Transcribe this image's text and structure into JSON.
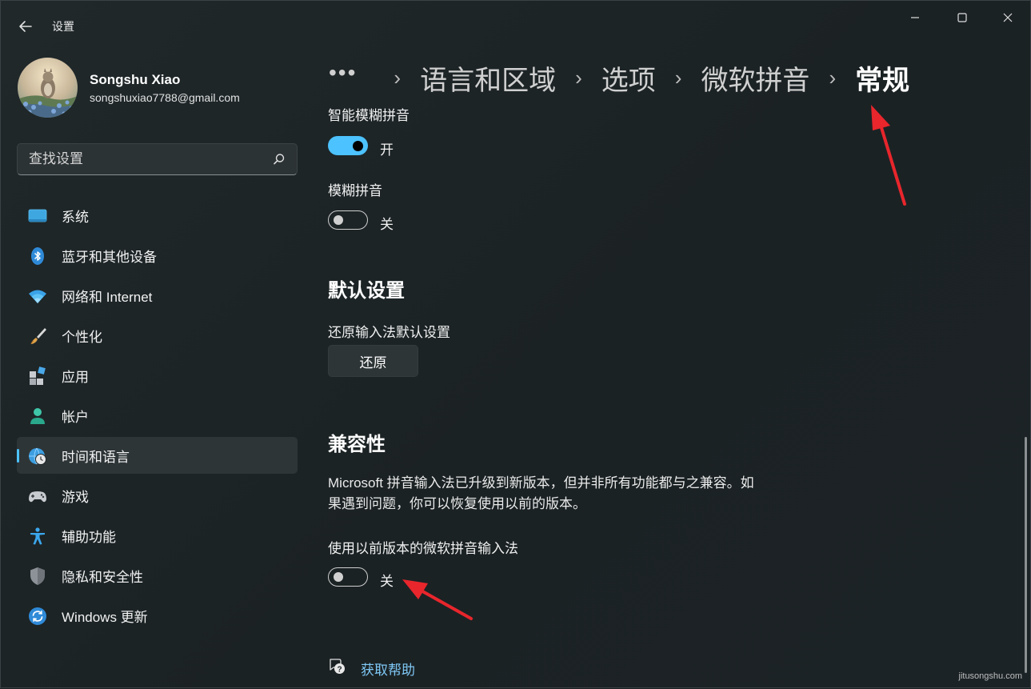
{
  "window": {
    "title": "设置",
    "controls": [
      "minimize-icon",
      "maximize-icon",
      "close-icon"
    ]
  },
  "profile": {
    "name": "Songshu Xiao",
    "email": "songshuxiao7788@gmail.com"
  },
  "search": {
    "placeholder": "查找设置"
  },
  "sidebar": {
    "items": [
      {
        "label": "系统",
        "icon": "system-icon",
        "active": false
      },
      {
        "label": "蓝牙和其他设备",
        "icon": "bluetooth-icon",
        "active": false
      },
      {
        "label": "网络和 Internet",
        "icon": "wifi-icon",
        "active": false
      },
      {
        "label": "个性化",
        "icon": "brush-icon",
        "active": false
      },
      {
        "label": "应用",
        "icon": "apps-icon",
        "active": false
      },
      {
        "label": "帐户",
        "icon": "account-icon",
        "active": false
      },
      {
        "label": "时间和语言",
        "icon": "globe-clock-icon",
        "active": true
      },
      {
        "label": "游戏",
        "icon": "gamepad-icon",
        "active": false
      },
      {
        "label": "辅助功能",
        "icon": "accessibility-icon",
        "active": false
      },
      {
        "label": "隐私和安全性",
        "icon": "shield-icon",
        "active": false
      },
      {
        "label": "Windows 更新",
        "icon": "update-icon",
        "active": false
      }
    ]
  },
  "breadcrumb": {
    "more": "•••",
    "items": [
      "语言和区域",
      "选项",
      "微软拼音"
    ],
    "current": "常规"
  },
  "content": {
    "smart_fuzzy": {
      "label": "智能模糊拼音",
      "state": "开",
      "on": true
    },
    "fuzzy": {
      "label": "模糊拼音",
      "state": "关",
      "on": false
    },
    "defaults_section": {
      "title": "默认设置",
      "restore_label": "还原输入法默认设置",
      "restore_button": "还原"
    },
    "compat_section": {
      "title": "兼容性",
      "description_line1": "Microsoft 拼音输入法已升级到新版本，但并非所有功能都与之兼容。如",
      "description_line2": "果遇到问题，你可以恢复使用以前的版本。",
      "legacy_label": "使用以前版本的微软拼音输入法",
      "legacy_state": "关",
      "legacy_on": false
    },
    "help_link": "获取帮助"
  },
  "watermark": "jitusongshu.com",
  "colors": {
    "accent": "#4cc2ff",
    "link": "#7fc8f6",
    "annotation_arrow": "#e8262c"
  }
}
